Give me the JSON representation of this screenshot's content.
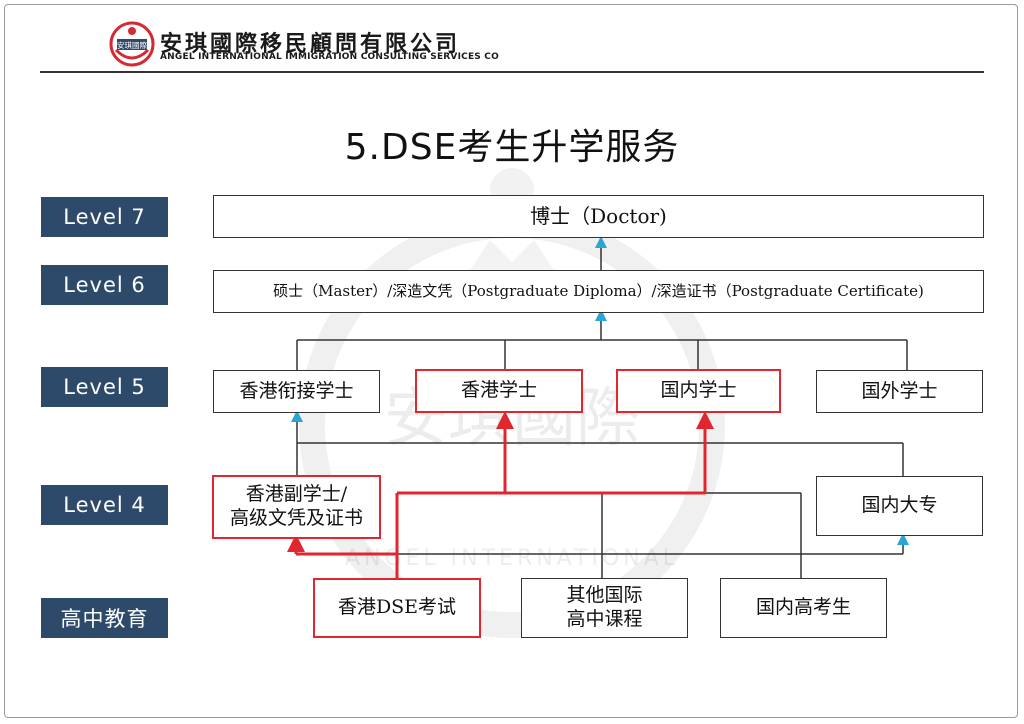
{
  "header": {
    "logo_badge_text": "安琪國際",
    "company_cn": "安琪國際移民顧問有限公司",
    "company_en": "ANGEL INTERNATIONAL IMMIGRATION CONSULTING SERVICES CO"
  },
  "title": "5.DSE考生升学服务",
  "watermark": {
    "text": "安琪國際",
    "ring_text": "ANGEL INTERNATIONAL"
  },
  "levels": [
    "Level 7",
    "Level 6",
    "Level 5",
    "Level 4",
    "高中教育"
  ],
  "nodes": {
    "doctor": "博士（Doctor)",
    "master": "硕士（Master）/深造文凭（Postgraduate Diploma）/深造证书（Postgraduate Certificate)",
    "hk_topup": "香港衔接学士",
    "hk_bachelor": "香港学士",
    "cn_bachelor": "国内学士",
    "overseas_bachelor": "国外学士",
    "hk_associate_line1": "香港副学士/",
    "hk_associate_line2": "高级文凭及证书",
    "cn_college": "国内大专",
    "hk_dse": "香港DSE考试",
    "other_intl_line1": "其他国际",
    "other_intl_line2": "高中课程",
    "gaokao": "国内高考生"
  },
  "colors": {
    "level_bg": "#2e4a6b",
    "highlight": "#e0262e",
    "arrow_blue": "#2aa6d6",
    "line": "#333333"
  }
}
